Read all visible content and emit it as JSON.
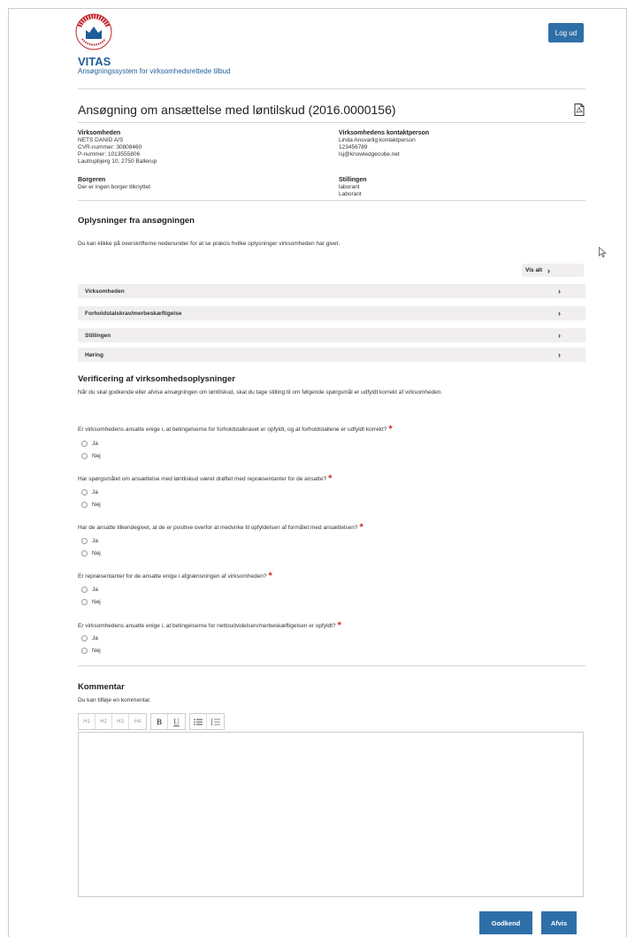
{
  "header": {
    "brand": "VITAS",
    "brand_subtitle": "Ansøgningssystem for virksomhedsrettede tilbud",
    "logout_label": "Log ud"
  },
  "application": {
    "title": "Ansøgning om ansættelse med løntilskud (2016.0000156)"
  },
  "info": {
    "company_label": "Virksomheden",
    "company_lines": [
      "NETS DANID A/S",
      "CVR-nummer: 30808460",
      "P-nummer: 1013555806",
      "Lautrupbjerg 10, 2750 Ballerup"
    ],
    "contact_label": "Virksomhedens kontaktperson",
    "contact_lines": [
      "Linda Ansvarlig kontaktperson",
      "123456789",
      "lsj@knowledgecube.net"
    ],
    "citizen_label": "Borgeren",
    "citizen_lines": [
      "Der er ingen borger tilknyttet"
    ],
    "position_label": "Stillingen",
    "position_lines": [
      "laborant",
      "Laborant"
    ]
  },
  "oplysninger": {
    "heading": "Oplysninger fra ansøgningen",
    "intro": "Du kan klikke på overskrifterne nedenunder for at se præcis hvilke oplysninger virksomheden har givet.",
    "show_all": "Vis alt",
    "sections": [
      "Virksomheden",
      "Forholdstalskrav/merbeskæftigelse",
      "Stillingen",
      "Høring"
    ]
  },
  "verification": {
    "heading": "Verificering af virksomhedsoplysninger",
    "intro": "Når du skal godkende eller afvise ansøgningen om løntilskud, skal du tage stilling til om følgende spørgsmål er udfyldt korrekt af virksomheden.",
    "required_mark": "*",
    "options": [
      "Ja",
      "Nej"
    ],
    "questions": [
      "Er virksomhedens ansatte enige i, at betingelserne for forholdstalkravet er opfyldt, og at forholdstallene er udfyldt korrekt?",
      "Har spørgsmålet om ansættelse med løntilskud været drøftet med repræsentanter for de ansatte?",
      "Har de ansatte tilkendegivet, at de er positive overfor at medvirke til opfyldelsen af formålet med ansættelsen?",
      "Er repræsentanter for de ansatte enige i afgrænsningen af virksomheden?",
      "Er virksomhedens ansatte enige i, at betingelserne for nettoudvidelsen/merbeskæftigelsen er opfyldt?"
    ]
  },
  "comment": {
    "heading": "Kommentar",
    "intro": "Du kan tilføje en kommentar.",
    "toolbar": {
      "headings": [
        "H1",
        "H2",
        "H3",
        "H4"
      ],
      "bold": "B",
      "underline": "U"
    }
  },
  "actions": {
    "approve": "Godkend",
    "reject": "Afvis"
  },
  "colors": {
    "primary": "#2f6fa8",
    "brand_text": "#1f5d98",
    "required": "#d42a2a",
    "accordion_bg": "#f0eeee"
  }
}
